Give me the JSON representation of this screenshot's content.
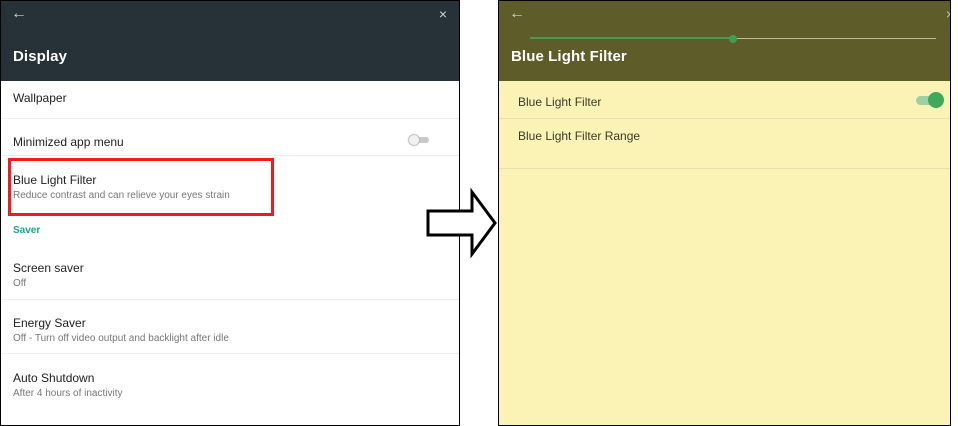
{
  "left": {
    "appbar": {
      "back_icon": "←",
      "close_icon": "×",
      "title": "Display"
    },
    "wallpaper": {
      "label": "Wallpaper"
    },
    "minimized_menu": {
      "label": "Minimized app menu",
      "toggle_on": false
    },
    "blue_light_filter": {
      "label": "Blue Light Filter",
      "subtitle": "Reduce contrast and can relieve your eyes strain"
    },
    "saver_section": {
      "label": "Saver"
    },
    "screen_saver": {
      "label": "Screen saver",
      "value": "Off"
    },
    "energy_saver": {
      "label": "Energy Saver",
      "value": "Off - Turn off video output and backlight after idle"
    },
    "auto_shutdown": {
      "label": "Auto Shutdown",
      "value": "After 4 hours of inactivity"
    }
  },
  "right": {
    "appbar": {
      "back_icon": "←",
      "close_icon": "×",
      "title": "Blue Light Filter"
    },
    "blf_toggle": {
      "label": "Blue Light Filter",
      "toggle_on": true
    },
    "range": {
      "label": "Blue Light Filter Range",
      "value_fraction": 0.5
    }
  },
  "colors": {
    "left_appbar": "#263238",
    "right_appbar": "#5e5c28",
    "right_background": "#fbf3b6",
    "highlight": "#ef1c1c",
    "accent_green": "#3fa85a",
    "section_teal": "#1aa88a"
  }
}
